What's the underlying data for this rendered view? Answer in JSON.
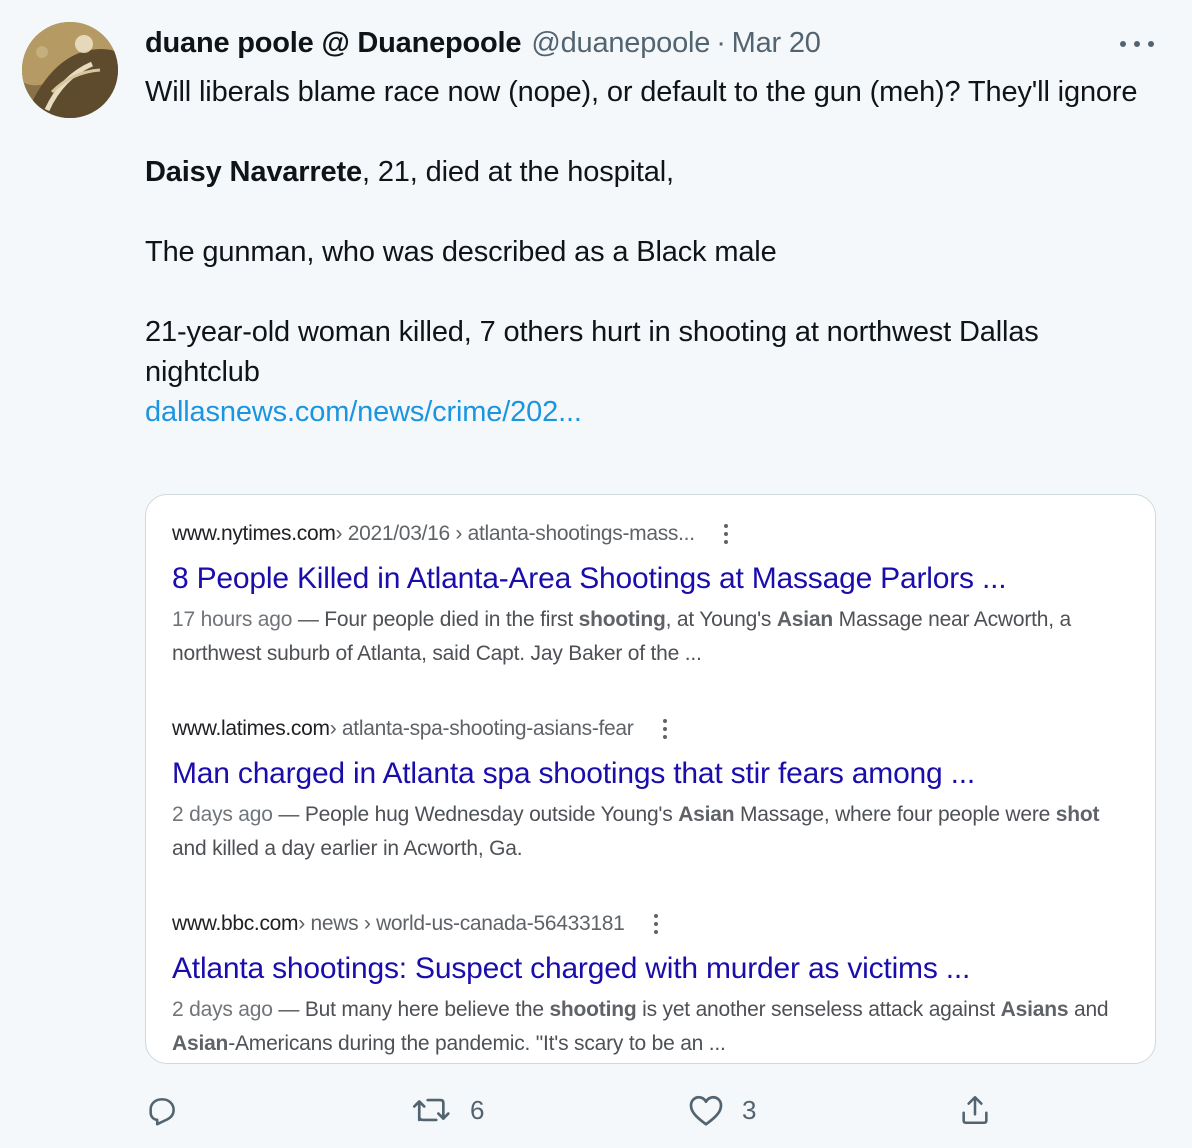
{
  "author": {
    "display_name": "duane poole @ Duanepoole",
    "handle": "@duanepoole",
    "separator": "·",
    "date": "Mar 20"
  },
  "tweet": {
    "line1": "Will liberals blame race now (nope), or default to the gun (meh)? They'll ignore",
    "victim_name": "Daisy Navarrete",
    "victim_rest": ", 21, died at the hospital,",
    "line3": "The gunman, who was described as a Black male",
    "line4": "21-year-old woman killed, 7 others hurt in shooting at northwest Dallas nightclub",
    "link": "dallasnews.com/news/crime/202..."
  },
  "results": [
    {
      "domain": "www.nytimes.com",
      "path": " › 2021/03/16 › atlanta-shootings-mass...",
      "title": "8 People Killed in Atlanta-Area Shootings at Massage Parlors ...",
      "age": "17 hours ago",
      "s1": " — Four people died in the first ",
      "b1": "shooting",
      "s2": ", at Young's ",
      "b2": "Asian",
      "s3": " Massage near Acworth, a northwest suburb of Atlanta, said Capt. Jay Baker of the ..."
    },
    {
      "domain": "www.latimes.com",
      "path": " › atlanta-spa-shooting-asians-fear",
      "title": "Man charged in Atlanta spa shootings that stir fears among ...",
      "age": "2 days ago",
      "s1": " — People hug Wednesday outside Young's ",
      "b1": "Asian",
      "s2": " Massage, where four people were ",
      "b2": "shot",
      "s3": " and killed a day earlier in Acworth, Ga."
    },
    {
      "domain": "www.bbc.com",
      "path": " › news › world-us-canada-56433181",
      "title": "Atlanta shootings: Suspect charged with murder as victims ...",
      "age": "2 days ago",
      "s1": " — But many here believe the ",
      "b1": "shooting",
      "s2": " is yet another senseless attack against ",
      "b2": "Asians",
      "s3": " and ",
      "b3": "Asian",
      "s4": "-Americans during the pandemic. \"It's scary to be an ..."
    }
  ],
  "actions": {
    "reply_icon": "reply-icon",
    "retweet_icon": "retweet-icon",
    "retweet_count": "6",
    "like_icon": "heart-icon",
    "like_count": "3",
    "share_icon": "share-icon"
  },
  "colors": {
    "background": "#f5f8fa",
    "link": "#1b95e0",
    "serp_title": "#1a0dab",
    "muted": "#536471"
  }
}
